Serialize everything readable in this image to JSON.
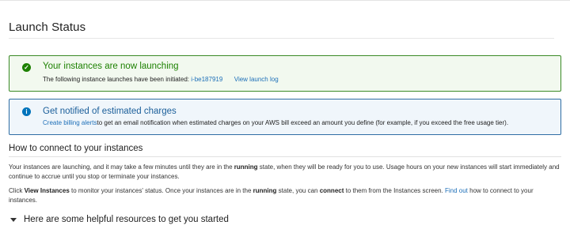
{
  "page": {
    "title": "Launch Status"
  },
  "success_alert": {
    "heading": "Your instances are now launching",
    "text": "The following instance launches have been initiated:",
    "instance_id": "i-be187919",
    "view_log": "View launch log"
  },
  "info_alert": {
    "heading": "Get notified of estimated charges",
    "link": "Create billing alerts",
    "text": "to get an email notification when estimated charges on your AWS bill exceed an amount you define (for example, if you exceed the free usage tier)."
  },
  "connect": {
    "title": "How to connect to your instances",
    "p1_a": "Your instances are launching, and it may take a few minutes until they are in the ",
    "p1_bold": "running",
    "p1_b": " state, when they will be ready for you to use. Usage hours on your new instances will start immediately and continue to accrue until you stop or terminate your instances.",
    "p2_a": "Click ",
    "p2_bold1": "View Instances",
    "p2_b": " to monitor your instances' status. Once your instances are in the ",
    "p2_bold2": "running",
    "p2_c": " state, you can ",
    "p2_bold3": "connect",
    "p2_d": " to them from the Instances screen. ",
    "p2_link": "Find out",
    "p2_e": " how to connect to your instances."
  },
  "resources": {
    "title": "Here are some helpful resources to get you started"
  },
  "colors": {
    "success": "#1d8102",
    "info": "#0073bb",
    "link": "#1d6fb8"
  }
}
